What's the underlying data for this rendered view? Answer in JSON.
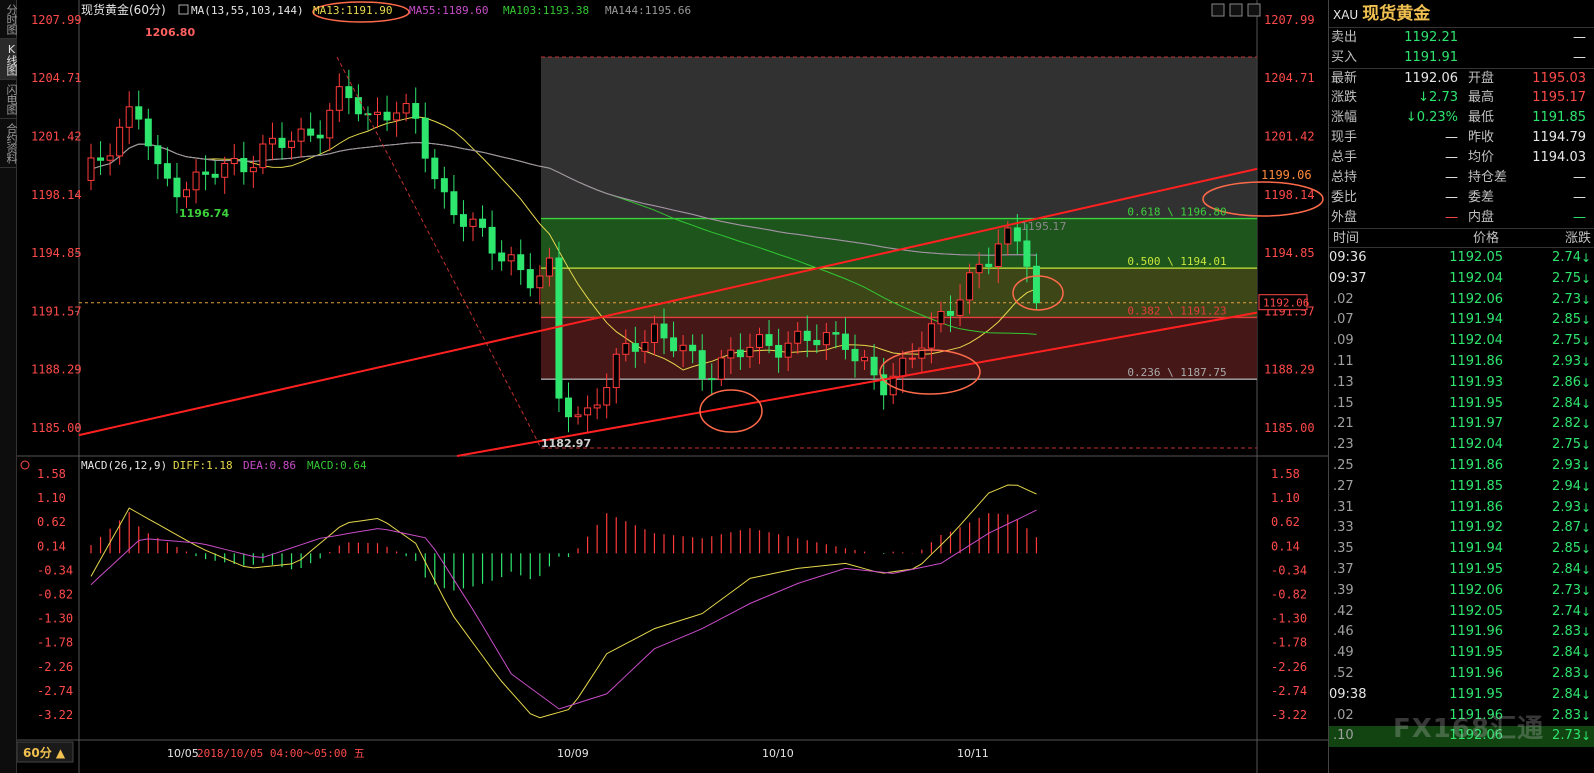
{
  "left_tabs": [
    "分时图",
    "K线图",
    "闪电图",
    "合约资料"
  ],
  "chart": {
    "title": "现货黄金(60分)",
    "ma_label": "MA(13,55,103,144)",
    "ma13": "MA13:1191.90",
    "ma55": "MA55:1189.60",
    "ma103": "MA103:1193.38",
    "ma144": "MA144:1195.66",
    "period_button": "60分 ▲",
    "status_time": "2018/10/05 04:00～05:00 五",
    "x_labels": [
      "10/05",
      "10/09",
      "10/10",
      "10/11"
    ],
    "price_axis": [
      "1207.99",
      "1204.71",
      "1201.42",
      "1198.14",
      "1194.85",
      "1191.57",
      "1188.29",
      "1185.00"
    ],
    "price_badges": {
      "current": "1192.06",
      "right_top": "1199.06"
    },
    "annotations": {
      "high": "1206.80",
      "low": "1182.97",
      "mid_low": "1196.74",
      "recent_high": "1195.17"
    },
    "fib": [
      {
        "label": "0.618 \\ 1196.80"
      },
      {
        "label": "0.500 \\ 1194.01"
      },
      {
        "label": "0.382 \\ 1191.23"
      },
      {
        "label": "0.236 \\ 1187.75"
      }
    ],
    "macd_label": "MACD(26,12,9)",
    "diff": "DIFF:1.18",
    "dea": "DEA:0.86",
    "macd": "MACD:0.64",
    "macd_axis": [
      "1.58",
      "1.10",
      "0.62",
      "0.14",
      "-0.34",
      "-0.82",
      "-1.30",
      "-1.78",
      "-2.26",
      "-2.74",
      "-3.22"
    ],
    "colors": {
      "up": "#ff3a3a",
      "down": "#2ee56e",
      "ma13": "#e6d84c",
      "ma55": "#32c832",
      "ma103": "#c84cc8",
      "ma144": "#9a9a9a",
      "channel": "#ff2020"
    }
  },
  "quote": {
    "code": "XAU",
    "name": "现货黄金",
    "rows": [
      {
        "k": "卖出",
        "v": "1192.21",
        "k2": "",
        "v2": "—"
      },
      {
        "k": "买入",
        "v": "1191.91",
        "k2": "",
        "v2": "—"
      },
      {
        "k": "最新",
        "v": "1192.06",
        "k2": "开盘",
        "v2": "1195.03"
      },
      {
        "k": "涨跌",
        "v": "↓2.73",
        "k2": "最高",
        "v2": "1195.17"
      },
      {
        "k": "涨幅",
        "v": "↓0.23%",
        "k2": "最低",
        "v2": "1191.85"
      },
      {
        "k": "现手",
        "v": "—",
        "k2": "昨收",
        "v2": "1194.79"
      },
      {
        "k": "总手",
        "v": "—",
        "k2": "均价",
        "v2": "1194.03"
      },
      {
        "k": "总持",
        "v": "—",
        "k2": "持仓差",
        "v2": "—"
      },
      {
        "k": "委比",
        "v": "—",
        "k2": "委差",
        "v2": "—"
      },
      {
        "k": "外盘",
        "v": "—",
        "k2": "内盘",
        "v2": "—"
      }
    ],
    "tick_headers": [
      "时间",
      "价格",
      "涨跌"
    ],
    "ticks": [
      {
        "t": "09:36",
        "p": "1192.05",
        "c": "2.74",
        "major": true
      },
      {
        "t": "09:37",
        "p": "1192.04",
        "c": "2.75",
        "major": true
      },
      {
        "t": ".02",
        "p": "1192.06",
        "c": "2.73"
      },
      {
        "t": ".07",
        "p": "1191.94",
        "c": "2.85"
      },
      {
        "t": ".09",
        "p": "1192.04",
        "c": "2.75"
      },
      {
        "t": ".11",
        "p": "1191.86",
        "c": "2.93"
      },
      {
        "t": ".13",
        "p": "1191.93",
        "c": "2.86"
      },
      {
        "t": ".15",
        "p": "1191.95",
        "c": "2.84"
      },
      {
        "t": ".21",
        "p": "1191.97",
        "c": "2.82"
      },
      {
        "t": ".23",
        "p": "1192.04",
        "c": "2.75"
      },
      {
        "t": ".25",
        "p": "1191.86",
        "c": "2.93"
      },
      {
        "t": ".27",
        "p": "1191.85",
        "c": "2.94"
      },
      {
        "t": ".31",
        "p": "1191.86",
        "c": "2.93"
      },
      {
        "t": ".33",
        "p": "1191.92",
        "c": "2.87"
      },
      {
        "t": ".35",
        "p": "1191.94",
        "c": "2.85"
      },
      {
        "t": ".37",
        "p": "1191.95",
        "c": "2.84"
      },
      {
        "t": ".39",
        "p": "1192.06",
        "c": "2.73"
      },
      {
        "t": ".42",
        "p": "1192.05",
        "c": "2.74"
      },
      {
        "t": ".46",
        "p": "1191.96",
        "c": "2.83"
      },
      {
        "t": ".49",
        "p": "1191.95",
        "c": "2.84"
      },
      {
        "t": ".52",
        "p": "1191.96",
        "c": "2.83"
      },
      {
        "t": "09:38",
        "p": "1191.95",
        "c": "2.84",
        "major": true
      },
      {
        "t": ".02",
        "p": "1191.96",
        "c": "2.83"
      },
      {
        "t": ".10",
        "p": "1192.06",
        "c": "2.73"
      }
    ],
    "watermark": "FX168汇通"
  }
}
